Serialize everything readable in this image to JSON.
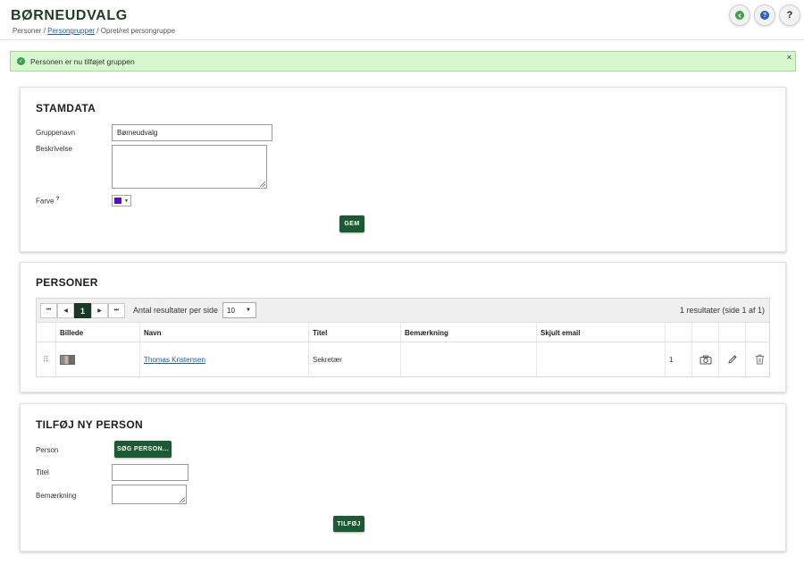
{
  "header": {
    "title": "BØRNEUDVALG",
    "breadcrumb": {
      "root": "Personer",
      "separator": " / ",
      "link": "Persongrupper",
      "current": "Opret/ret persongruppe"
    },
    "buttons": [
      {
        "name": "back-button",
        "icon": "back-arrow-icon",
        "color": "#3aa34a"
      },
      {
        "name": "help-button",
        "icon": "help-circle-icon",
        "color": "#2a5fbf"
      },
      {
        "name": "question-button",
        "label": "?"
      }
    ]
  },
  "alert": {
    "message": "Personen er nu tilføjet gruppen",
    "close_label": "×",
    "color": "#d7f7cf"
  },
  "stamdata": {
    "heading": "STAMDATA",
    "group_name_label": "Gruppenavn",
    "group_name_value": "Børneudvalg",
    "description_label": "Beskrivelse",
    "description_value": "",
    "color_label": "Farve",
    "color_help": "?",
    "color_value": "#5a0fb5",
    "save_label": "GEM"
  },
  "personer": {
    "heading": "PERSONER",
    "pager": {
      "first": "⏮",
      "prev": "◀",
      "current_page": "1",
      "next": "▶",
      "last": "⏭"
    },
    "per_page_label": "Antal resultater per side",
    "per_page_value": "10",
    "result_count": "1 resultater (side 1 af 1)",
    "columns": [
      "Billede",
      "Navn",
      "Titel",
      "Bemærkning",
      "Skjult email"
    ],
    "rows": [
      {
        "name": "Thomas Kristensen",
        "title": "Sekretær",
        "note": "",
        "hidden_email": "",
        "order": "1"
      }
    ]
  },
  "add_person": {
    "heading": "TILFØJ NY PERSON",
    "person_label": "Person",
    "search_button_label": "SØG PERSON...",
    "title_label": "Titel",
    "title_value": "",
    "note_label": "Bemærkning",
    "note_value": "",
    "add_button_label": "TILFØJ"
  },
  "colors": {
    "brand_green": "#1c5a34",
    "active_page": "#163a23",
    "link": "#1f5fa6"
  }
}
